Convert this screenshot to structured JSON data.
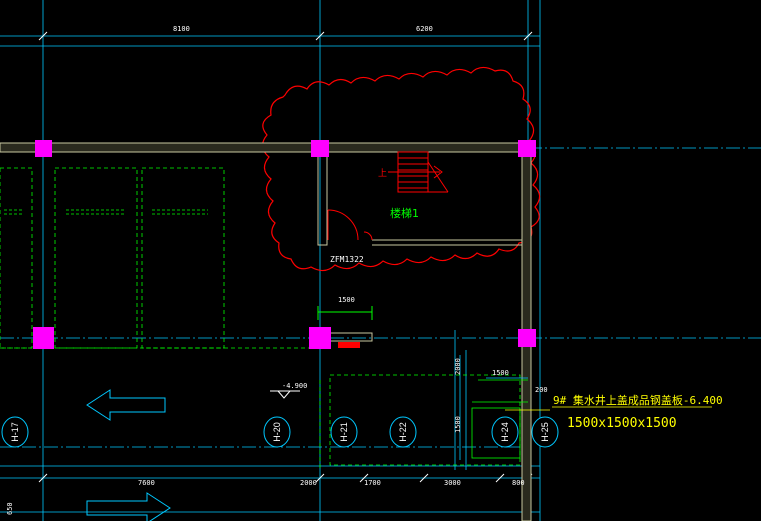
{
  "top_dimensions": [
    "8100",
    "6200"
  ],
  "bottom_dimensions": [
    "7600",
    "2000",
    "1700",
    "3000",
    "800"
  ],
  "left_edge_dim": "650",
  "axis_labels": [
    "H-17",
    "H-20",
    "H-21",
    "H-22",
    "H-24",
    "H-25"
  ],
  "room_label": "楼梯1",
  "stair_up_mark": "上",
  "door_tag": "ZFM1322",
  "door_width_dim": "1500",
  "elevation_mark": "-4.900",
  "pit_dims": {
    "top": "1500",
    "right_top": "200",
    "left_v1": "2000",
    "left_v2": "1500"
  },
  "pit_note_line1": "9# 集水井上盖成品钢盖板-6.400",
  "pit_note_line2": "1500x1500x1500",
  "colors": {
    "background": "#000000",
    "grid": "#00c8ff",
    "wall": "#c8c8a0",
    "column": "#ff00ff",
    "cloud": "#ff0000",
    "hidden": "#00ff00",
    "text": "#ffffff",
    "note": "#ffff00"
  }
}
